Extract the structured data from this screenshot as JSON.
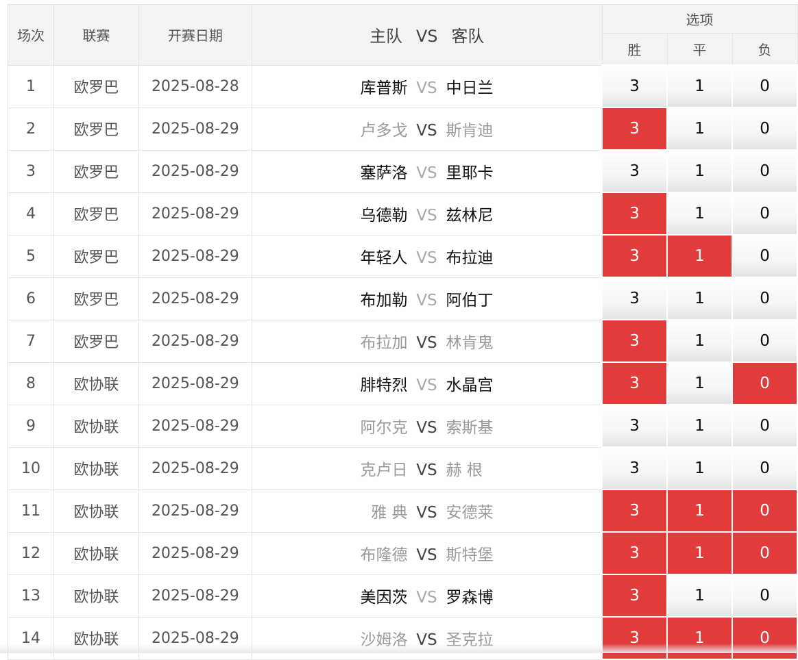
{
  "header": {
    "col_no": "场次",
    "col_league": "联赛",
    "col_date": "开赛日期",
    "col_home": "主队",
    "col_vs": "VS",
    "col_away": "客队",
    "col_options": "选项",
    "opt_win": "胜",
    "opt_draw": "平",
    "opt_lose": "负"
  },
  "colors": {
    "selected": "#e13b3b",
    "header_bg": "#f3f3f3"
  },
  "rows": [
    {
      "no": "1",
      "league": "欧罗巴",
      "date": "2025-08-28",
      "home": "库普斯",
      "vs": "VS",
      "away": "中日兰",
      "win": "3",
      "draw": "1",
      "lose": "0",
      "style": "dark",
      "sel_win": false,
      "sel_draw": false,
      "sel_lose": false
    },
    {
      "no": "2",
      "league": "欧罗巴",
      "date": "2025-08-29",
      "home": "卢多戈",
      "vs": "VS",
      "away": "斯肯迪",
      "win": "3",
      "draw": "1",
      "lose": "0",
      "style": "light",
      "sel_win": true,
      "sel_draw": false,
      "sel_lose": false
    },
    {
      "no": "3",
      "league": "欧罗巴",
      "date": "2025-08-29",
      "home": "塞萨洛",
      "vs": "VS",
      "away": "里耶卡",
      "win": "3",
      "draw": "1",
      "lose": "0",
      "style": "dark",
      "sel_win": false,
      "sel_draw": false,
      "sel_lose": false
    },
    {
      "no": "4",
      "league": "欧罗巴",
      "date": "2025-08-29",
      "home": "乌德勒",
      "vs": "VS",
      "away": "兹林尼",
      "win": "3",
      "draw": "1",
      "lose": "0",
      "style": "dark",
      "sel_win": true,
      "sel_draw": false,
      "sel_lose": false
    },
    {
      "no": "5",
      "league": "欧罗巴",
      "date": "2025-08-29",
      "home": "年轻人",
      "vs": "VS",
      "away": "布拉迪",
      "win": "3",
      "draw": "1",
      "lose": "0",
      "style": "dark",
      "sel_win": true,
      "sel_draw": true,
      "sel_lose": false
    },
    {
      "no": "6",
      "league": "欧罗巴",
      "date": "2025-08-29",
      "home": "布加勒",
      "vs": "VS",
      "away": "阿伯丁",
      "win": "3",
      "draw": "1",
      "lose": "0",
      "style": "dark",
      "sel_win": false,
      "sel_draw": false,
      "sel_lose": false
    },
    {
      "no": "7",
      "league": "欧罗巴",
      "date": "2025-08-29",
      "home": "布拉加",
      "vs": "VS",
      "away": "林肯鬼",
      "win": "3",
      "draw": "1",
      "lose": "0",
      "style": "light",
      "sel_win": true,
      "sel_draw": false,
      "sel_lose": false
    },
    {
      "no": "8",
      "league": "欧协联",
      "date": "2025-08-29",
      "home": "腓特烈",
      "vs": "VS",
      "away": "水晶宫",
      "win": "3",
      "draw": "1",
      "lose": "0",
      "style": "dark",
      "sel_win": true,
      "sel_draw": false,
      "sel_lose": true
    },
    {
      "no": "9",
      "league": "欧协联",
      "date": "2025-08-29",
      "home": "阿尔克",
      "vs": "VS",
      "away": "索斯基",
      "win": "3",
      "draw": "1",
      "lose": "0",
      "style": "light",
      "sel_win": false,
      "sel_draw": false,
      "sel_lose": false
    },
    {
      "no": "10",
      "league": "欧协联",
      "date": "2025-08-29",
      "home": "克卢日",
      "vs": "VS",
      "away": "赫 根",
      "win": "3",
      "draw": "1",
      "lose": "0",
      "style": "light",
      "sel_win": false,
      "sel_draw": false,
      "sel_lose": false
    },
    {
      "no": "11",
      "league": "欧协联",
      "date": "2025-08-29",
      "home": "雅 典",
      "vs": "VS",
      "away": "安德莱",
      "win": "3",
      "draw": "1",
      "lose": "0",
      "style": "light",
      "sel_win": true,
      "sel_draw": true,
      "sel_lose": true
    },
    {
      "no": "12",
      "league": "欧协联",
      "date": "2025-08-29",
      "home": "布隆德",
      "vs": "VS",
      "away": "斯特堡",
      "win": "3",
      "draw": "1",
      "lose": "0",
      "style": "light",
      "sel_win": true,
      "sel_draw": true,
      "sel_lose": true
    },
    {
      "no": "13",
      "league": "欧协联",
      "date": "2025-08-29",
      "home": "美因茨",
      "vs": "VS",
      "away": "罗森博",
      "win": "3",
      "draw": "1",
      "lose": "0",
      "style": "dark",
      "sel_win": true,
      "sel_draw": false,
      "sel_lose": false
    },
    {
      "no": "14",
      "league": "欧协联",
      "date": "2025-08-29",
      "home": "沙姆洛",
      "vs": "VS",
      "away": "圣克拉",
      "win": "3",
      "draw": "1",
      "lose": "0",
      "style": "light",
      "sel_win": true,
      "sel_draw": true,
      "sel_lose": true
    }
  ]
}
